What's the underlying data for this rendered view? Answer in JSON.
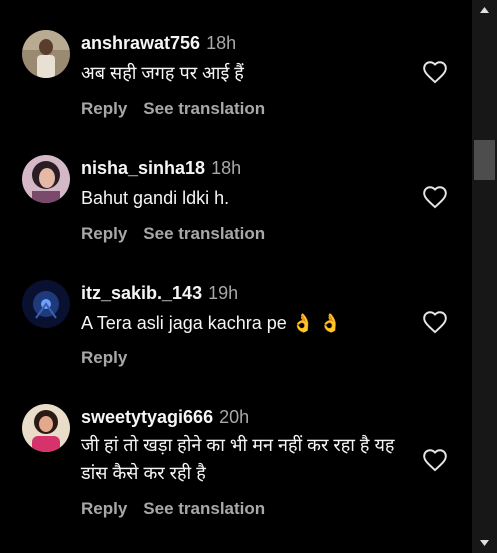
{
  "comments": [
    {
      "username": "anshrawat756",
      "time": "18h",
      "text": "अब सही जगह पर आई हैं",
      "actions": {
        "reply": "Reply",
        "translate": "See translation"
      }
    },
    {
      "username": "nisha_sinha18",
      "time": "18h",
      "text": "Bahut gandi ldki h.",
      "actions": {
        "reply": "Reply",
        "translate": "See translation"
      }
    },
    {
      "username": "itz_sakib._143",
      "time": "19h",
      "text": "A Tera asli jaga kachra pe 👌 👌",
      "actions": {
        "reply": "Reply"
      }
    },
    {
      "username": "sweetytyagi666",
      "time": "20h",
      "text": "जी हां तो खड़ा होने का भी मन नहीं कर रहा है यह डांस कैसे कर रही है",
      "actions": {
        "reply": "Reply",
        "translate": "See translation"
      }
    }
  ],
  "icons": {
    "like": "heart-outline-icon",
    "scroll_up": "triangle-up-icon",
    "scroll_down": "triangle-down-icon"
  },
  "colors": {
    "background": "#000000",
    "primary_text": "#f5f5f5",
    "secondary_text": "#a8a8a8",
    "scrollbar_track": "#171717",
    "scrollbar_thumb": "#4d4d4d"
  }
}
